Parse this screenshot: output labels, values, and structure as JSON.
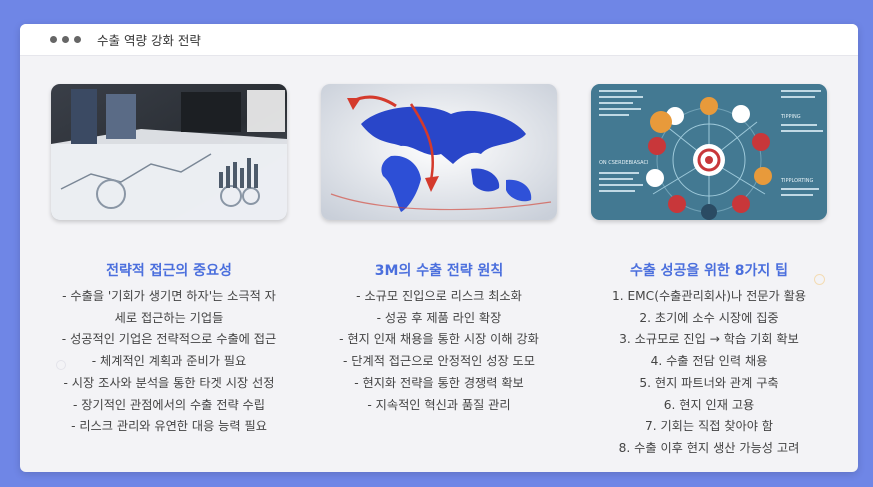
{
  "window": {
    "title": "수출 역량 강화 전략"
  },
  "columns": [
    {
      "heading": "전략적 접근의 중요성",
      "image": "business-data-charts-image",
      "items": [
        "- 수출을 '기회가 생기면 하자'는 소극적 자",
        "세로 접근하는 기업들",
        "- 성공적인 기업은 전략적으로 수출에 접근",
        "- 체계적인 계획과 준비가 필요",
        "- 시장 조사와 분석을 통한 타겟 시장 선정",
        "- 장기적인 관점에서의 수출 전략 수립",
        "- 리스크 관리와 유연한 대응 능력 필요"
      ]
    },
    {
      "heading": "3M의 수출 전략 원칙",
      "image": "world-map-export-image",
      "items": [
        "- 소규모 진입으로 리스크 최소화",
        "- 성공 후 제품 라인 확장",
        "- 현지 인재 채용을 통한 시장 이해 강화",
        "- 단계적 접근으로 안정적인 성장 도모",
        "- 현지화 전략을 통한 경쟁력 확보",
        "- 지속적인 혁신과 품질 관리"
      ]
    },
    {
      "heading": "수출 성공을 위한 8가지 팁",
      "image": "export-infographic-image",
      "items": [
        "1. EMC(수출관리회사)나 전문가 활용",
        "2. 초기에 소수 시장에 집중",
        "3. 소규모로 진입 → 학습 기회 확보",
        "4. 수출 전담 인력 채용",
        "5. 현지 파트너와 관계 구축",
        "6. 현지 인재 고용",
        "7. 기회는 직접 찾아야 함",
        "8. 수출 이후 현지 생산 가능성 고려"
      ]
    }
  ],
  "infographic_labels": {
    "left": "ON CSERDEBIASACI",
    "right_top": "TIPPING",
    "right_mid": "TIPPLORTING"
  },
  "colors": {
    "background": "#6f86e6",
    "accent": "#4b6fdd"
  }
}
